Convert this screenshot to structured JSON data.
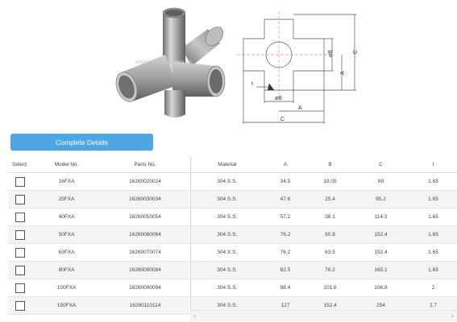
{
  "watermark": "www.hwa-kai.com.tw",
  "drawing": {
    "labels": {
      "phiB_top": "øB",
      "A_right": "A",
      "C_right": "C",
      "t": "t",
      "phiB_bottom": "øB",
      "A_bottom": "A",
      "C_bottom": "C"
    }
  },
  "button": {
    "label": "Complete Details"
  },
  "table": {
    "headers": {
      "select": "Select",
      "model": "Model No.",
      "parts": "Parts No.",
      "material": "Material",
      "a": "A",
      "b": "B",
      "c": "C",
      "t": "t"
    },
    "rows": [
      {
        "model": "16FXA",
        "parts": "16260020024",
        "material": "304 S.S.",
        "a": "34.5",
        "b": "19.05",
        "c": "69",
        "t": "1.65"
      },
      {
        "model": "25FXA",
        "parts": "16260030034",
        "material": "304 S.S.",
        "a": "47.6",
        "b": "25.4",
        "c": "95.2",
        "t": "1.65"
      },
      {
        "model": "40FXA",
        "parts": "16260050054",
        "material": "304 S.S.",
        "a": "57.2",
        "b": "38.1",
        "c": "114.3",
        "t": "1.65"
      },
      {
        "model": "50FXA",
        "parts": "16260060064",
        "material": "304 S.S.",
        "a": "76.2",
        "b": "50.8",
        "c": "152.4",
        "t": "1.65"
      },
      {
        "model": "63FXA",
        "parts": "16260070074",
        "material": "304 S.S.",
        "a": "76.2",
        "b": "63.5",
        "c": "152.4",
        "t": "1.65"
      },
      {
        "model": "80FXA",
        "parts": "16260080084",
        "material": "304 S.S.",
        "a": "82.5",
        "b": "76.2",
        "c": "165.1",
        "t": "1.65"
      },
      {
        "model": "100FXA",
        "parts": "16260090094",
        "material": "304 S.S.",
        "a": "98.4",
        "b": "101.6",
        "c": "196.8",
        "t": "2"
      },
      {
        "model": "150FXA",
        "parts": "16260110114",
        "material": "304 S.S.",
        "a": "127",
        "b": "152.4",
        "c": "254",
        "t": "2.7"
      }
    ]
  },
  "scrollbar": {
    "left_arrow": "‹",
    "right_arrow": "›"
  }
}
